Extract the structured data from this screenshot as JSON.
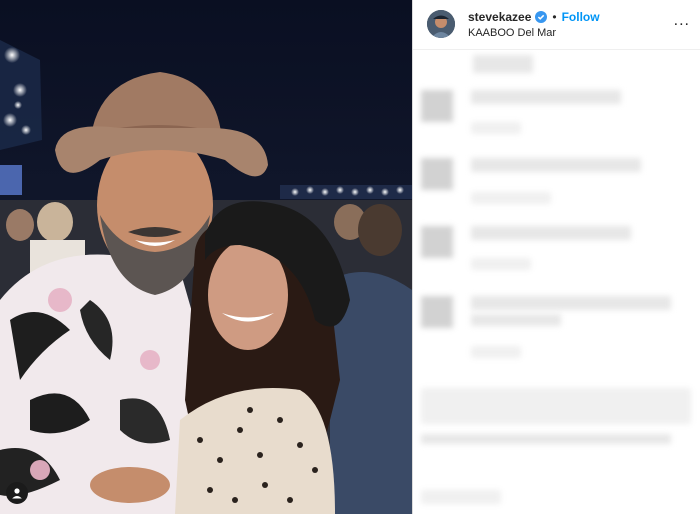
{
  "post": {
    "username": "stevekazee",
    "follow_label": "Follow",
    "location": "KAABOO Del Mar",
    "separator": "•",
    "more_label": "..."
  },
  "icons": {
    "verified": "verified-badge-icon",
    "tag": "user-tag-icon",
    "more": "more-options-icon"
  },
  "colors": {
    "follow": "#0095f6",
    "verified": "#3897f0"
  }
}
